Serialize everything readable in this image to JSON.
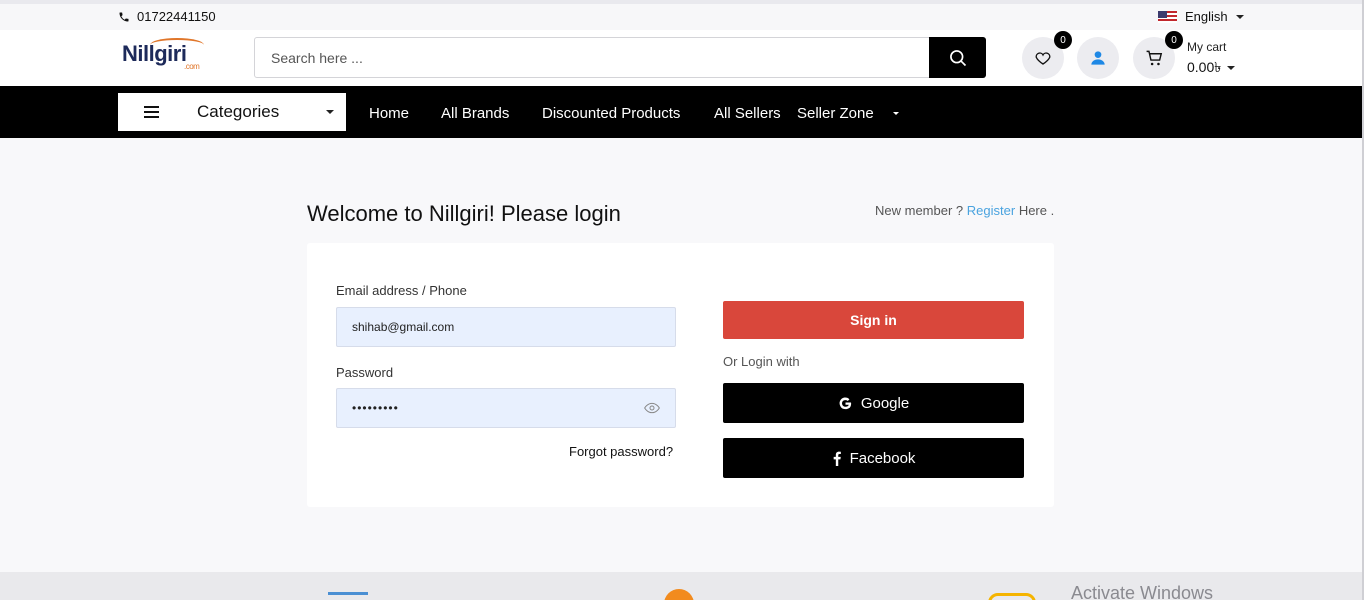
{
  "topbar": {
    "phone": "01722441150",
    "language": "English"
  },
  "header": {
    "logo_text": "Nillgiri",
    "logo_sub": ".com",
    "search_placeholder": "Search here ...",
    "wishlist_count": "0",
    "cart_count": "0",
    "cart_label": "My cart",
    "cart_total": "0.00৳"
  },
  "nav": {
    "categories_label": "Categories",
    "links": [
      "Home",
      "All Brands",
      "Discounted Products",
      "All Sellers",
      "Seller Zone"
    ]
  },
  "login": {
    "title": "Welcome to Nillgiri! Please login",
    "new_member": "New member ?",
    "register": "Register",
    "here": "Here .",
    "email_label": "Email address / Phone",
    "email_value": "shihab@gmail.com",
    "password_label": "Password",
    "password_value": "•••••••••",
    "forgot": "Forgot password?",
    "signin": "Sign in",
    "or_login": "Or Login with",
    "google": "Google",
    "facebook": "Facebook"
  },
  "footer": {
    "watermark": "Activate Windows"
  }
}
